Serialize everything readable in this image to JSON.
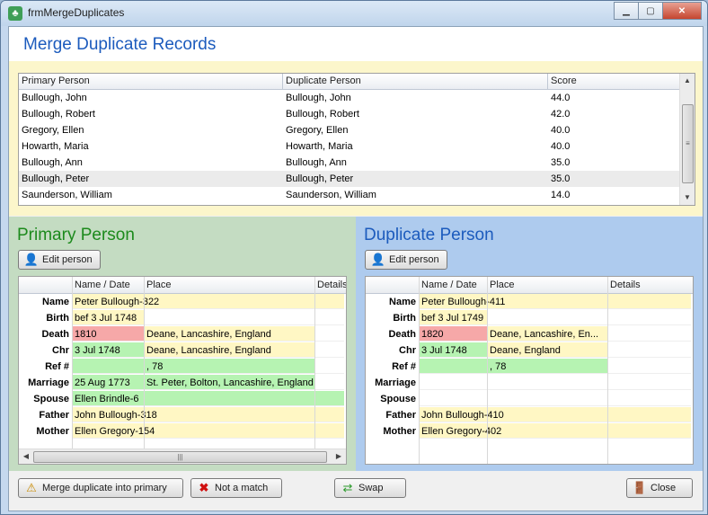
{
  "window": {
    "title": "frmMergeDuplicates",
    "icon": "tree-app-icon"
  },
  "header": {
    "title": "Merge Duplicate Records"
  },
  "duplicates_list": {
    "columns": [
      "Primary Person",
      "Duplicate Person",
      "Score"
    ],
    "rows": [
      [
        "Bullough, John",
        "Bullough, John",
        "44.0"
      ],
      [
        "Bullough, Robert",
        "Bullough, Robert",
        "42.0"
      ],
      [
        "Gregory, Ellen",
        "Gregory, Ellen",
        "40.0"
      ],
      [
        "Howarth, Maria",
        "Howarth, Maria",
        "40.0"
      ],
      [
        "Bullough, Ann",
        "Bullough, Ann",
        "35.0"
      ],
      [
        "Bullough, Peter",
        "Bullough, Peter",
        "35.0"
      ],
      [
        "Saunderson, William",
        "Saunderson, William",
        "14.0"
      ]
    ],
    "selected_row": "Bullough, Peter"
  },
  "grid_columns": [
    "Name / Date",
    "Place",
    "Details"
  ],
  "primary": {
    "title": "Primary Person",
    "edit_label": "Edit person",
    "rows": [
      {
        "label": "Name",
        "date": "Peter Bullough-322",
        "place": "",
        "details": ""
      },
      {
        "label": "Birth",
        "date": "bef 3 Jul 1748",
        "place": "",
        "details": ""
      },
      {
        "label": "Death",
        "date": "1810",
        "place": "Deane, Lancashire, England",
        "details": ""
      },
      {
        "label": "Chr",
        "date": "3 Jul 1748",
        "place": "Deane, Lancashire, England",
        "details": ""
      },
      {
        "label": "Ref #",
        "date": "",
        "place": ", 78",
        "details": ""
      },
      {
        "label": "Marriage",
        "date": "25 Aug 1773",
        "place": "St. Peter, Bolton, Lancashire, England",
        "details": ""
      },
      {
        "label": "Spouse",
        "date": "Ellen Brindle-6",
        "place": "",
        "details": ""
      },
      {
        "label": "Father",
        "date": "John Bullough-318",
        "place": "",
        "details": ""
      },
      {
        "label": "Mother",
        "date": "Ellen Gregory-154",
        "place": "",
        "details": ""
      }
    ]
  },
  "duplicate": {
    "title": "Duplicate Person",
    "edit_label": "Edit person",
    "rows": [
      {
        "label": "Name",
        "date": "Peter Bullough-411",
        "place": "",
        "details": ""
      },
      {
        "label": "Birth",
        "date": "bef 3 Jul 1749",
        "place": "",
        "details": ""
      },
      {
        "label": "Death",
        "date": "1820",
        "place": "Deane, Lancashire, En...",
        "details": ""
      },
      {
        "label": "Chr",
        "date": "3 Jul 1748",
        "place": "Deane, England",
        "details": ""
      },
      {
        "label": "Ref #",
        "date": "",
        "place": ", 78",
        "details": ""
      },
      {
        "label": "Marriage",
        "date": "",
        "place": "",
        "details": ""
      },
      {
        "label": "Spouse",
        "date": "",
        "place": "",
        "details": ""
      },
      {
        "label": "Father",
        "date": "John Bullough-410",
        "place": "",
        "details": ""
      },
      {
        "label": "Mother",
        "date": "Ellen Gregory-402",
        "place": "",
        "details": ""
      }
    ]
  },
  "footer": {
    "merge_label": "Merge duplicate into primary",
    "not_match_label": "Not a match",
    "swap_label": "Swap",
    "close_label": "Close"
  },
  "colors": {
    "match": "#b6f3b2",
    "partial": "#fff7c4",
    "conflict": "#f6a8a8",
    "primary_panel": "#c4dcc2",
    "duplicate_panel": "#aecbee",
    "title_blue": "#1c5bbd",
    "title_green": "#1c8a1c"
  }
}
